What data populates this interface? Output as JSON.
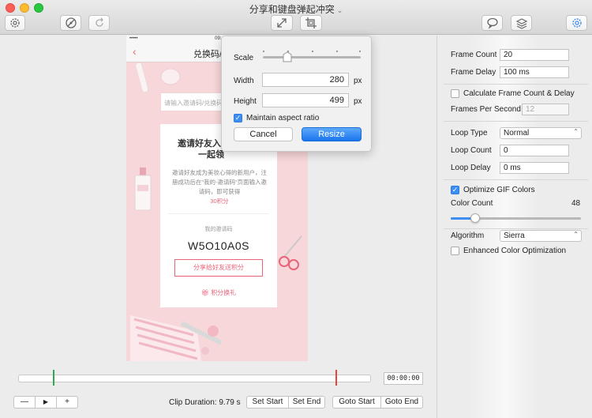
{
  "window": {
    "title": "分享和键盘弹起冲突"
  },
  "phone": {
    "status_carrier": "•••••  ",
    "status_time": "09:",
    "nav_title": "兑换码/",
    "input_placeholder": "请输入邀请码/兑换码",
    "card_heading_1": "邀请好友入",
    "card_heading_2": "一起领",
    "card_desc_1": "邀请好友成为美妆心得的新用户，注册成功后在“我的-邀请码”页面输入邀请码，即可获得",
    "card_desc_points": "30积分",
    "my_code_label": "我的邀请码",
    "invite_code": "W5O10A0S",
    "share_button": "分享给好友送积分",
    "gift_link": "积分换礼"
  },
  "resize_popover": {
    "scale_label": "Scale",
    "width_label": "Width",
    "width_value": "280",
    "height_label": "Height",
    "height_value": "499",
    "unit": "px",
    "maintain_aspect_label": "Maintain aspect ratio",
    "maintain_aspect_checked": true,
    "cancel_label": "Cancel",
    "resize_label": "Resize"
  },
  "settings": {
    "frame_count_label": "Frame Count",
    "frame_count_value": "20",
    "frame_delay_label": "Frame Delay",
    "frame_delay_value": "100 ms",
    "calc_frame_label": "Calculate Frame Count & Delay",
    "calc_frame_checked": false,
    "fps_label": "Frames Per Second",
    "fps_value": "12",
    "loop_type_label": "Loop Type",
    "loop_type_value": "Normal",
    "loop_count_label": "Loop Count",
    "loop_count_value": "0",
    "loop_delay_label": "Loop Delay",
    "loop_delay_value": "0 ms",
    "optimize_gif_label": "Optimize GIF Colors",
    "optimize_gif_checked": true,
    "color_count_label": "Color Count",
    "color_count_value": "48",
    "color_count_fraction": 0.19,
    "algorithm_label": "Algorithm",
    "algorithm_value": "Sierra",
    "enhanced_label": "Enhanced Color Optimization",
    "enhanced_checked": false
  },
  "timeline": {
    "time": "00:00:00",
    "start_marker_color": "#2fa84f",
    "end_marker_color": "#e0483a",
    "clip_duration": "Clip Duration: 9.79 s"
  },
  "controls": {
    "zoom_out": "—",
    "play": "▶",
    "zoom_in": "+",
    "set_start": "Set Start",
    "set_end": "Set End",
    "goto_start": "Goto Start",
    "goto_end": "Goto End"
  },
  "colors": {
    "accent": "#3c8ef3",
    "pink": "#e8647a"
  }
}
